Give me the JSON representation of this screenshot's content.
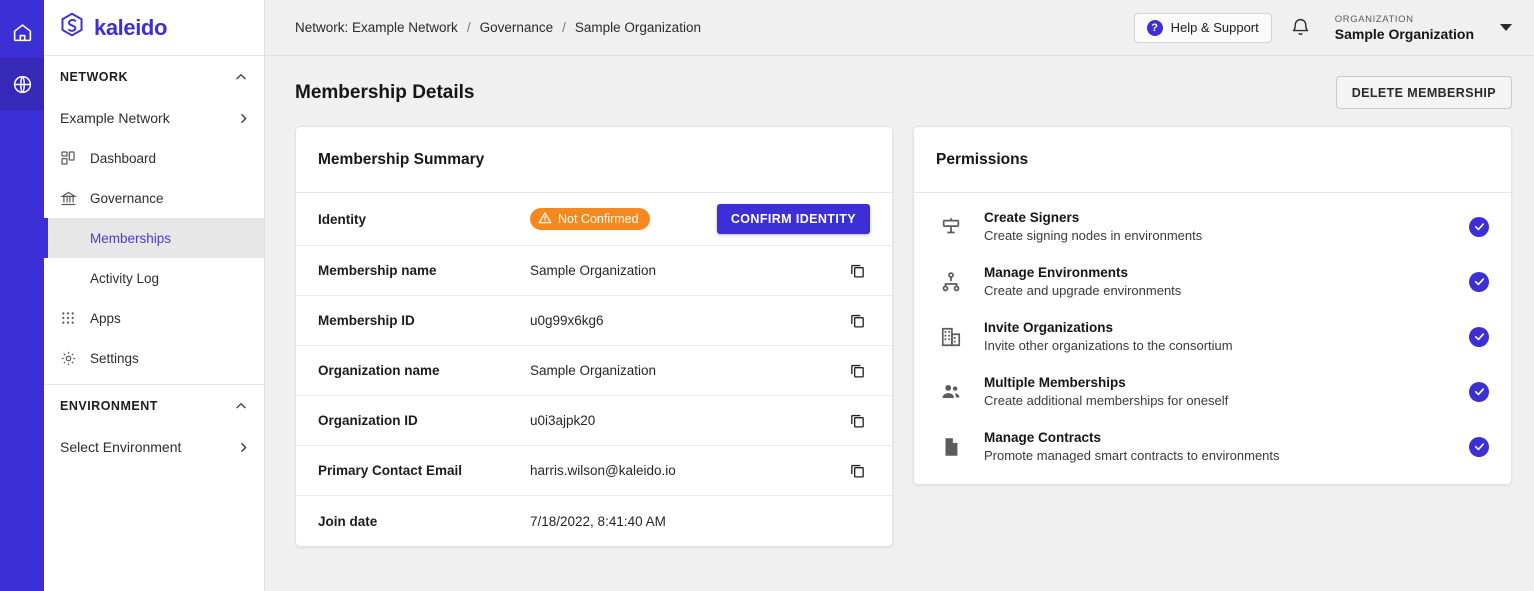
{
  "rail": {
    "items": [
      {
        "name": "home",
        "icon": "home-icon",
        "active": false
      },
      {
        "name": "globe",
        "icon": "globe-icon",
        "active": true
      }
    ]
  },
  "sidebar": {
    "brand": "kaleido",
    "sections": [
      {
        "title": "NETWORK",
        "collapse_icon": "chevron-up-icon",
        "items": [
          {
            "label": "Example Network",
            "icon": null,
            "trailing": "chevron-right-icon",
            "level": "top",
            "active": false
          },
          {
            "label": "Dashboard",
            "icon": "dashboard-icon",
            "level": "item",
            "active": false
          },
          {
            "label": "Governance",
            "icon": "governance-icon",
            "level": "item",
            "active": false
          },
          {
            "label": "Memberships",
            "icon": null,
            "level": "sub",
            "active": true
          },
          {
            "label": "Activity Log",
            "icon": null,
            "level": "sub",
            "active": false
          },
          {
            "label": "Apps",
            "icon": "apps-icon",
            "level": "item",
            "active": false
          },
          {
            "label": "Settings",
            "icon": "gear-icon",
            "level": "item",
            "active": false
          }
        ]
      },
      {
        "title": "ENVIRONMENT",
        "collapse_icon": "chevron-up-icon",
        "items": [
          {
            "label": "Select Environment",
            "icon": null,
            "trailing": "chevron-right-icon",
            "level": "top",
            "active": false
          }
        ]
      }
    ]
  },
  "topbar": {
    "breadcrumb": [
      "Network: Example Network",
      "Governance",
      "Sample Organization"
    ],
    "separator": "/",
    "help_label": "Help & Support",
    "help_icon": "question-mark-icon",
    "bell_icon": "bell-icon",
    "org_label": "ORGANIZATION",
    "org_name": "Sample Organization",
    "org_caret": "triangle-down-icon"
  },
  "page": {
    "title": "Membership Details",
    "delete_button": "DELETE MEMBERSHIP"
  },
  "summary": {
    "heading": "Membership Summary",
    "identity": {
      "label": "Identity",
      "badge_text": "Not Confirmed",
      "badge_icon": "warning-triangle-icon",
      "badge_color": "#f5891f",
      "button_label": "CONFIRM IDENTITY",
      "button_color": "#3d2fd6"
    },
    "rows": [
      {
        "label": "Membership name",
        "value": "Sample Organization",
        "copy": true
      },
      {
        "label": "Membership ID",
        "value": "u0g99x6kg6",
        "copy": true
      },
      {
        "label": "Organization name",
        "value": "Sample Organization",
        "copy": true
      },
      {
        "label": "Organization ID",
        "value": "u0i3ajpk20",
        "copy": true
      },
      {
        "label": "Primary Contact Email",
        "value": "harris.wilson@kaleido.io",
        "copy": true
      },
      {
        "label": "Join date",
        "value": "7/18/2022, 8:41:40 AM",
        "copy": false
      }
    ],
    "copy_icon": "copy-icon"
  },
  "permissions": {
    "heading": "Permissions",
    "check_icon": "check-circle-icon",
    "check_color": "#3d2fd6",
    "items": [
      {
        "title": "Create Signers",
        "desc": "Create signing nodes in environments",
        "icon": "signer-node-icon",
        "granted": true
      },
      {
        "title": "Manage Environments",
        "desc": "Create and upgrade environments",
        "icon": "hierarchy-icon",
        "granted": true
      },
      {
        "title": "Invite Organizations",
        "desc": "Invite other organizations to the consortium",
        "icon": "building-icon",
        "granted": true
      },
      {
        "title": "Multiple Memberships",
        "desc": "Create additional memberships for oneself",
        "icon": "people-icon",
        "granted": true
      },
      {
        "title": "Manage Contracts",
        "desc": "Promote managed smart contracts to environments",
        "icon": "document-icon",
        "granted": true
      }
    ]
  },
  "colors": {
    "brand": "#3d2fd6",
    "rail_active": "#3629b8",
    "warning": "#f5891f",
    "bg": "#f0f0f0"
  }
}
